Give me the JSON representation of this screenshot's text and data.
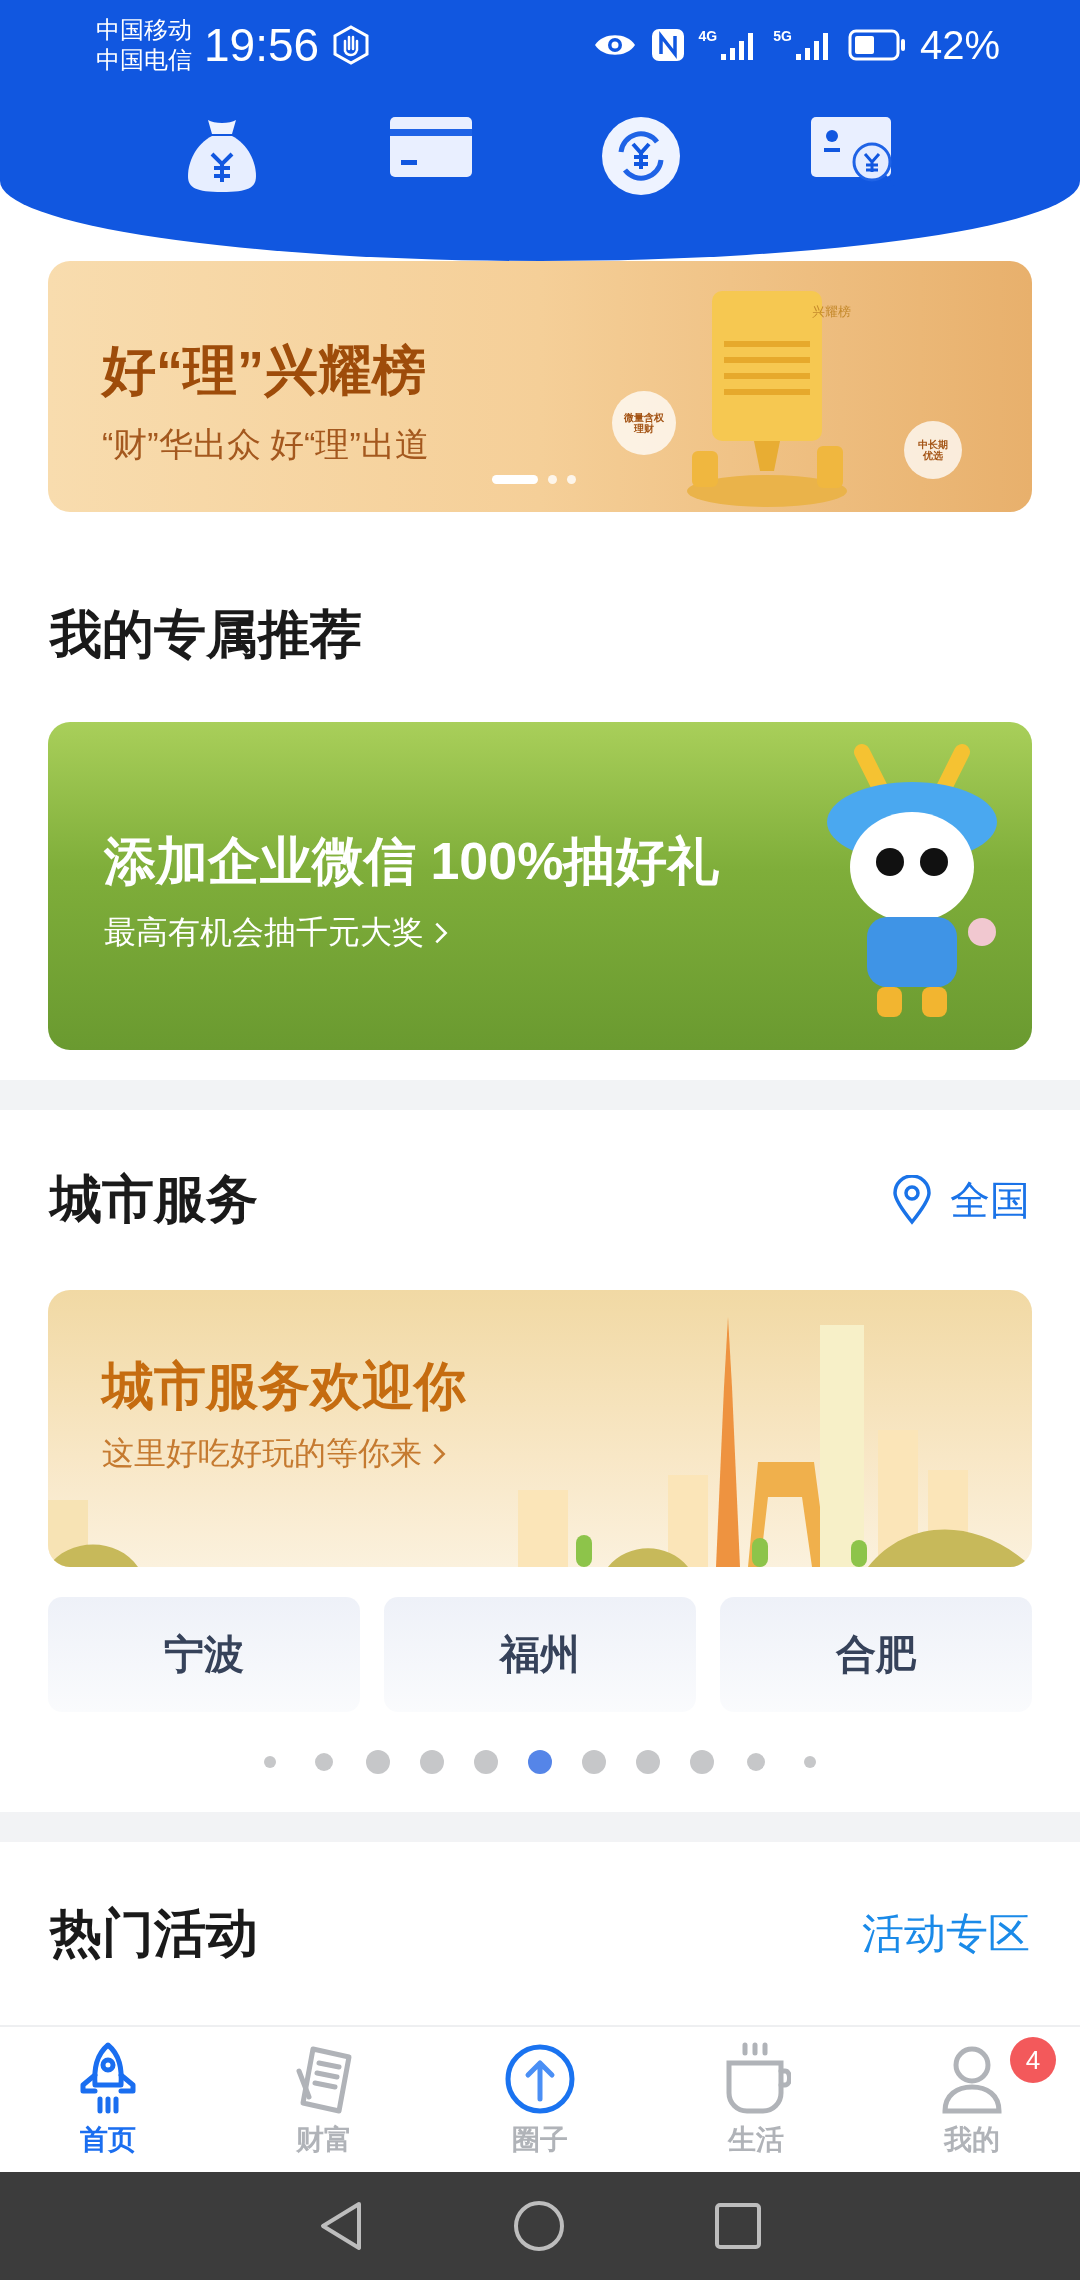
{
  "status_bar": {
    "carriers": [
      "中国移动",
      "中国电信"
    ],
    "time": "19:56",
    "network_labels": [
      "4G",
      "5G"
    ],
    "battery": "42%"
  },
  "promo_banner": {
    "title": "好“理”兴耀榜",
    "subtitle": "“财”华出众 好“理”出道",
    "board_label": "兴耀榜",
    "bubbles": [
      "微量含权理财",
      "中长期优选"
    ],
    "dots": [
      {
        "selected": true
      },
      {
        "selected": false
      },
      {
        "selected": false
      }
    ]
  },
  "recommend": {
    "title": "我的专属推荐",
    "banner": {
      "title": "添加企业微信 100%抽好礼",
      "subtitle": "最高有机会抽千元大奖"
    }
  },
  "city_service": {
    "title": "城市服务",
    "location": "全国",
    "banner": {
      "title": "城市服务欢迎你",
      "subtitle": "这里好吃好玩的等你来"
    },
    "cities": [
      "宁波",
      "福州",
      "合肥"
    ],
    "dots": [
      {
        "selected": false
      },
      {
        "selected": false
      },
      {
        "selected": false
      },
      {
        "selected": false
      },
      {
        "selected": false
      },
      {
        "selected": true
      },
      {
        "selected": false
      },
      {
        "selected": false
      },
      {
        "selected": false
      },
      {
        "selected": false
      },
      {
        "selected": false
      }
    ]
  },
  "hot_activities": {
    "title": "热门活动",
    "link": "活动专区"
  },
  "tab_bar": [
    {
      "label": "首页",
      "selected": true
    },
    {
      "label": "财富",
      "selected": false
    },
    {
      "label": "圈子",
      "selected": false
    },
    {
      "label": "生活",
      "selected": false
    },
    {
      "label": "我的",
      "selected": false,
      "badge": "4"
    }
  ]
}
